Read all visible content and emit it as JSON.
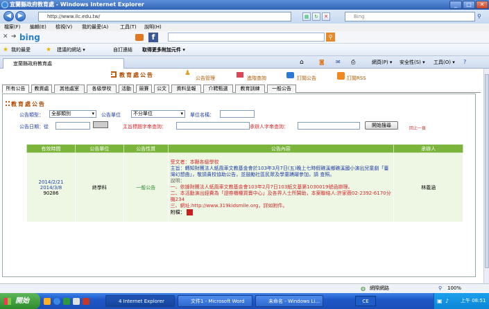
{
  "window": {
    "title": "宜蘭縣政府教育處 - Windows Internet Explorer"
  },
  "address": {
    "url": "http://www.ilc.edu.tw/",
    "search_placeholder": "Bing"
  },
  "menu": [
    "檔案(F)",
    "編輯(E)",
    "檢視(V)",
    "我的最愛(A)",
    "工具(T)",
    "說明(H)"
  ],
  "bing": {
    "logo": "bing"
  },
  "favorites": {
    "label": "我的最愛",
    "items": [
      "建議的網站 ▾",
      "自訂連結",
      "取得更多附加元件 ▾"
    ]
  },
  "page_tab": {
    "label": "宜蘭縣政府教育處"
  },
  "commands": [
    "網頁(P) ▾",
    "安全性(S) ▾",
    "工具(O) ▾"
  ],
  "header": {
    "title": "教育處公告",
    "links": [
      "公告管理",
      "進階查詢",
      "訂閱公告",
      "訂閱RSS"
    ]
  },
  "category_tabs": [
    "所有公告",
    "教資處",
    "其他處室",
    "各級學校",
    "活動",
    "競賽",
    "公文",
    "資料呈報",
    "介聘甄選",
    "教育訓練",
    "一般公告"
  ],
  "form": {
    "section_title": "教育處公告",
    "type_label": "公告類型：",
    "type_value": "全部類別",
    "unit_label": "公告單位",
    "unit_value": "不分單位",
    "unit_name_label": "單位名稱：",
    "date_label": "公告日期：從",
    "title_search_label": "主旨標題字串查詢：",
    "contact_search_label": "承辦人字串查詢：",
    "search_button": "開始搜尋",
    "prev_page": "回上一頁"
  },
  "table": {
    "headers": [
      "有效時間",
      "公告單位",
      "公告性質",
      "公告內容",
      "承辦人"
    ],
    "rows": [
      {
        "date_from": "2014/2/21",
        "date_to": "2014/3/8",
        "id": "90286",
        "unit": "終學科",
        "type": "一般公告",
        "recipient": "受文者：本縣各級學校",
        "subject": "主旨：轉知財團法人紙風車文教基金會於103年3月7日(五)晚上七時假礁溪鄉礁溪國小演出兒童劇「臺灣幻想曲」，敬請貴校協助公告，並鼓勵社區民眾及學童踴躍參加，請 查照。",
        "explain_label": "說明：",
        "lines": [
          "一、依據財團法人紙風車文教基金會103年2月7日103紙文基第1030019號函辦理。",
          "二、本活動演出經費為「證券櫃檯買賣中心」及各界人士所贊助，本案聯絡人:許家薇02-2392-6170分機234",
          "三、網址:http://www.319kidsmile.org，詳如附件。"
        ],
        "attachment_label": "附檔：",
        "contact": "林義涵"
      }
    ]
  },
  "status": {
    "zone": "網際網路",
    "zoom": "100%"
  },
  "taskbar": {
    "start": "開始",
    "tasks": [
      "4 Internet Explorer",
      "文件1 - Microsoft Word",
      "未命名 - Windows Li..."
    ],
    "ime": "CE",
    "clock": "上午 08:51"
  }
}
